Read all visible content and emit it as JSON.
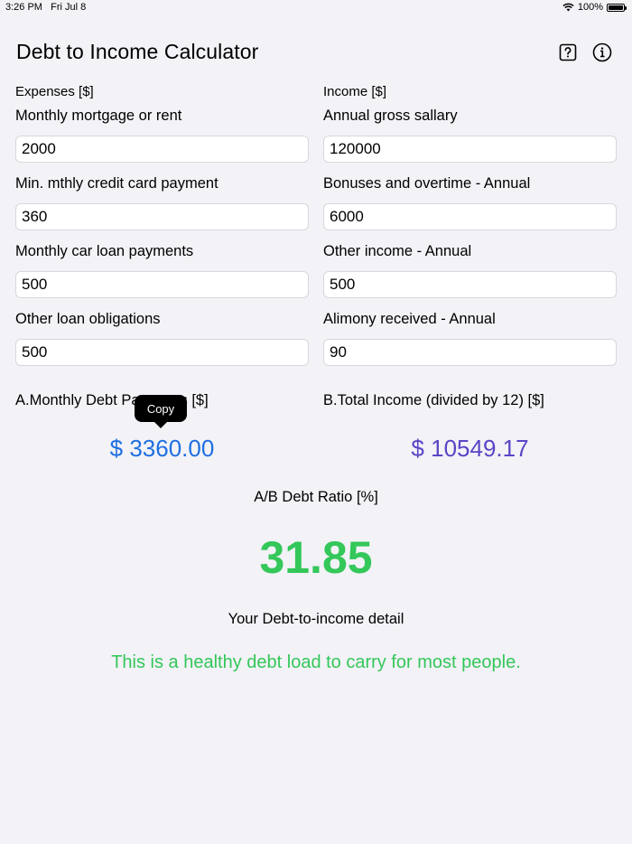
{
  "status_bar": {
    "time": "3:26 PM",
    "date": "Fri Jul 8",
    "battery": "100%"
  },
  "header": {
    "title": "Debt to Income Calculator",
    "help_icon": "question-mark-square-icon",
    "info_icon": "info-circle-icon"
  },
  "expenses": {
    "section_label": "Expenses [$]",
    "fields": [
      {
        "label": "Monthly mortgage or rent",
        "value": "2000"
      },
      {
        "label": "Min. mthly credit card payment",
        "value": "360"
      },
      {
        "label": "Monthly car loan payments",
        "value": "500"
      },
      {
        "label": "Other loan obligations",
        "value": "500"
      }
    ]
  },
  "income": {
    "section_label": "Income [$]",
    "fields": [
      {
        "label": "Annual gross sallary",
        "value": "120000"
      },
      {
        "label": "Bonuses and overtime - Annual",
        "value": "6000"
      },
      {
        "label": "Other income - Annual",
        "value": "500"
      },
      {
        "label": "Alimony received - Annual",
        "value": "90"
      }
    ]
  },
  "summary": {
    "debt_label": "A.Monthly Debt Payments [$]",
    "debt_value": "$ 3360.00",
    "income_label": "B.Total Income (divided by 12) [$]",
    "income_value": "$ 10549.17",
    "tooltip": "Copy"
  },
  "ratio": {
    "label": "A/B Debt Ratio [%]",
    "value": "31.85",
    "detail_label": "Your Debt-to-income detail",
    "detail_text": "This is a healthy debt load to carry for most people."
  },
  "colors": {
    "debt_blue": "#1e6fe0",
    "income_purple": "#5b45c6",
    "healthy_green": "#34c759"
  }
}
